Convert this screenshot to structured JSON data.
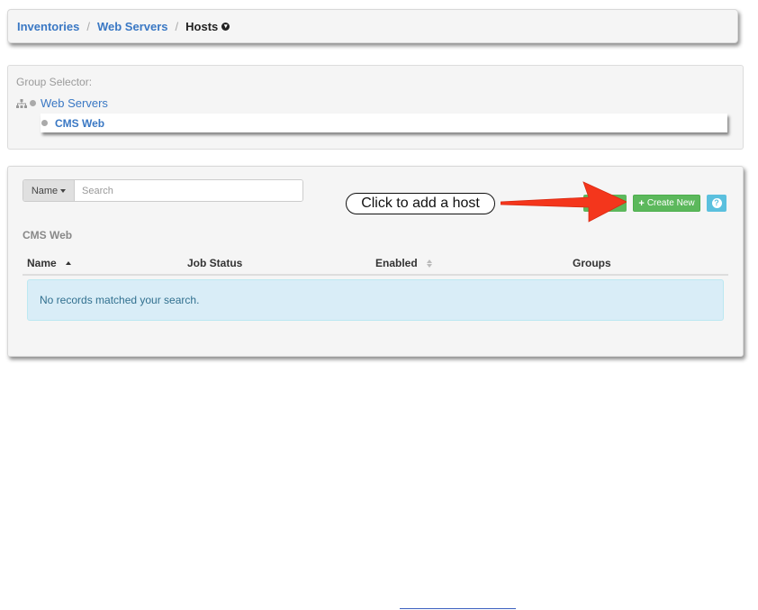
{
  "breadcrumb": {
    "items": [
      "Inventories",
      "Web Servers"
    ],
    "separator": "/",
    "active": "Hosts"
  },
  "group_selector": {
    "title": "Group Selector:",
    "root": "Web Servers",
    "selected": "CMS Web"
  },
  "search": {
    "field_label": "Name",
    "placeholder": "Search"
  },
  "toolbar": {
    "create_label": "Create New",
    "help_label": "?"
  },
  "list": {
    "title": "CMS Web",
    "columns": [
      "Name",
      "Job Status",
      "Enabled",
      "Groups"
    ],
    "empty_message": "No records matched your search."
  },
  "annotation": {
    "text": "Click to add a host"
  },
  "colors": {
    "link": "#3a78c4",
    "success": "#5cb85c",
    "info": "#5bc0de",
    "arrow": "#f4361c"
  },
  "icons": {
    "tree": "sitemap-icon",
    "help": "question-circle-icon",
    "add": "plus-icon"
  }
}
